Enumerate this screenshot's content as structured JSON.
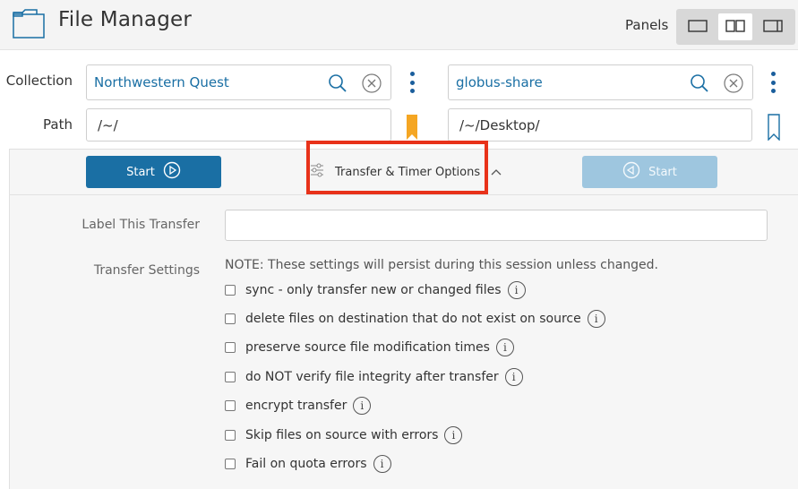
{
  "app": {
    "title": "File Manager",
    "icon": "folder-icon"
  },
  "panels": {
    "label": "Panels",
    "options": [
      "single-panel",
      "dual-panel",
      "right-panel"
    ],
    "selected": "dual-panel"
  },
  "collection": {
    "label": "Collection",
    "left": {
      "value": "Northwestern Quest"
    },
    "right": {
      "value": "globus-share"
    }
  },
  "path": {
    "label": "Path",
    "left": {
      "value": "/~/",
      "bookmark": "bookmark-filled-icon"
    },
    "right": {
      "value": "/~/Desktop/",
      "bookmark": "bookmark-outline-icon"
    }
  },
  "actions": {
    "start_left": "Start",
    "start_right": "Start",
    "options_toggle": "Transfer & Timer Options"
  },
  "options": {
    "label_this_transfer": "Label This Transfer",
    "label_value": "",
    "transfer_settings": "Transfer Settings",
    "note": "NOTE: These settings will persist during this session unless changed.",
    "items": [
      {
        "label": "sync - only transfer new or changed files",
        "checked": false
      },
      {
        "label": "delete files on destination that do not exist on source",
        "checked": false
      },
      {
        "label": "preserve source file modification times",
        "checked": false
      },
      {
        "label": "do NOT verify file integrity after transfer",
        "checked": false
      },
      {
        "label": "encrypt transfer",
        "checked": false
      },
      {
        "label": "Skip files on source with errors",
        "checked": false
      },
      {
        "label": "Fail on quota errors",
        "checked": false
      }
    ]
  },
  "colors": {
    "primary": "#1a6fa4",
    "primary_disabled": "#9ec6df",
    "highlight": "#e8321a",
    "bookmark_active": "#f5a623"
  }
}
